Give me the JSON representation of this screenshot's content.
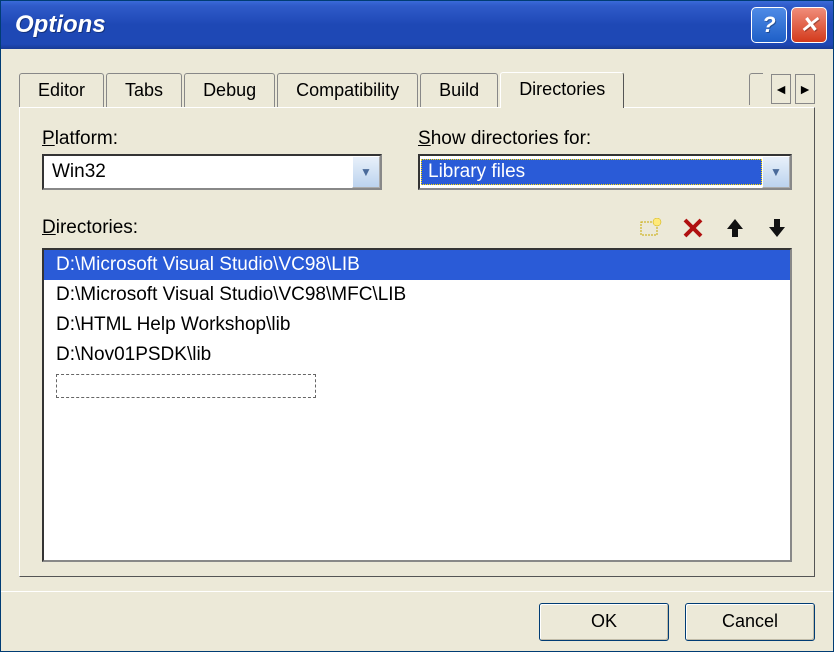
{
  "window": {
    "title": "Options"
  },
  "tabs": {
    "items": [
      "Editor",
      "Tabs",
      "Debug",
      "Compatibility",
      "Build",
      "Directories"
    ],
    "active": "Directories"
  },
  "form": {
    "platform_label": "Platform:",
    "platform_value": "Win32",
    "showdir_label": "Show directories for:",
    "showdir_value": "Library files",
    "directories_label": "Directories:"
  },
  "directories": [
    "D:\\Microsoft Visual Studio\\VC98\\LIB",
    "D:\\Microsoft Visual Studio\\VC98\\MFC\\LIB",
    "D:\\HTML Help Workshop\\lib",
    "D:\\Nov01PSDK\\lib"
  ],
  "selected_directory_index": 0,
  "buttons": {
    "ok": "OK",
    "cancel": "Cancel"
  },
  "icons": {
    "new": "new-folder-icon",
    "delete": "delete-icon",
    "up": "move-up-icon",
    "down": "move-down-icon"
  }
}
